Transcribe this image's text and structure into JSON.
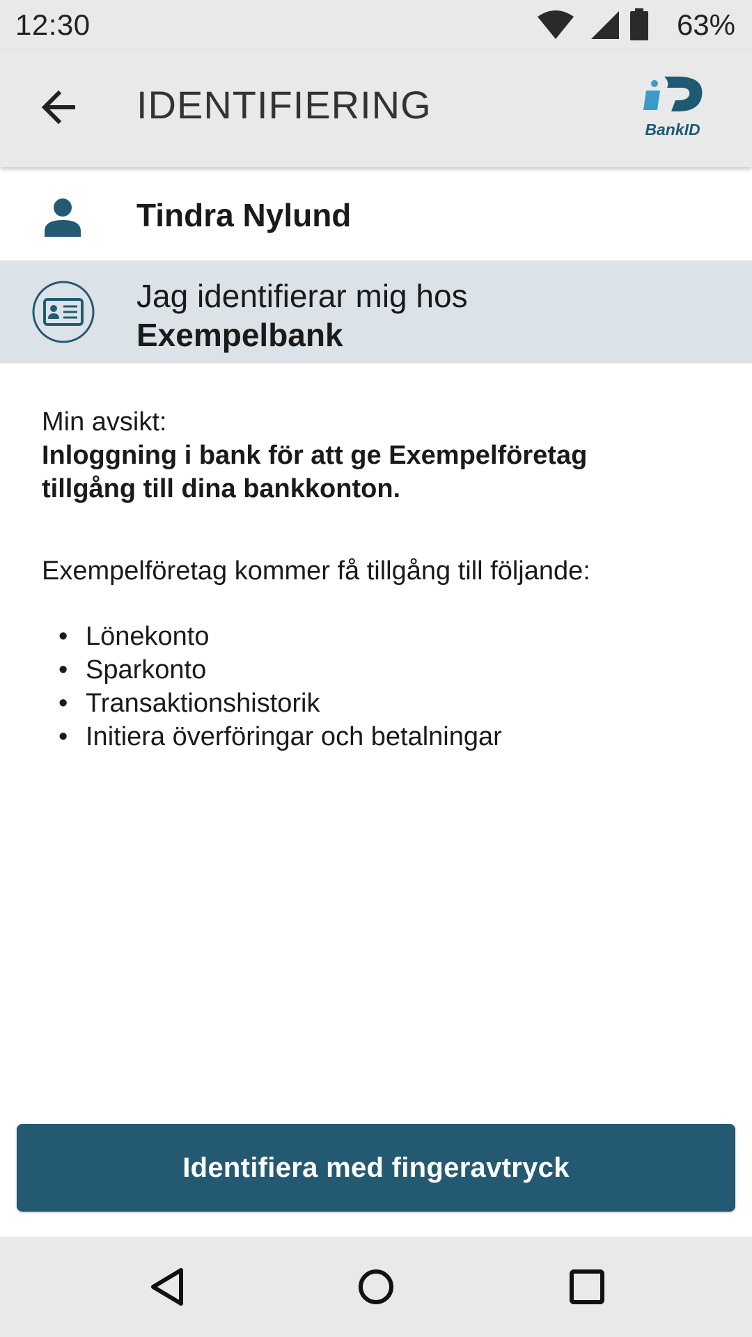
{
  "status_bar": {
    "time": "12:30",
    "battery_percent": "63%",
    "icons": [
      "wifi-icon",
      "signal-icon",
      "battery-icon"
    ]
  },
  "app_bar": {
    "back_icon": "arrow-back-icon",
    "title": "IDENTIFIERING",
    "logo_text": "BankID"
  },
  "user": {
    "icon": "person-icon",
    "name": "Tindra Nylund"
  },
  "relying_party": {
    "icon": "id-card-icon",
    "intro": "Jag identifierar mig hos",
    "name": "Exempelbank"
  },
  "content": {
    "intent_label": "Min avsikt:",
    "intent_text": "Inloggning i bank för att ge Exempelföretag tillgång till dina bankkonton.",
    "access_intro": "Exempelföretag kommer få tillgång till följande:",
    "access_items": [
      "Lönekonto",
      "Sparkonto",
      "Transaktionshistorik",
      "Initiera överföringar och betalningar"
    ]
  },
  "action": {
    "button_label": "Identifiera med fingeravtryck"
  },
  "nav_bar": {
    "icons": [
      "nav-back-icon",
      "nav-home-icon",
      "nav-recents-icon"
    ]
  },
  "colors": {
    "accent": "#235a72",
    "highlight_row": "#dbe3e8",
    "bar_background": "#e9e9e9",
    "bankid_blue_light": "#3a9bc8",
    "bankid_blue_dark": "#1f5a75"
  }
}
